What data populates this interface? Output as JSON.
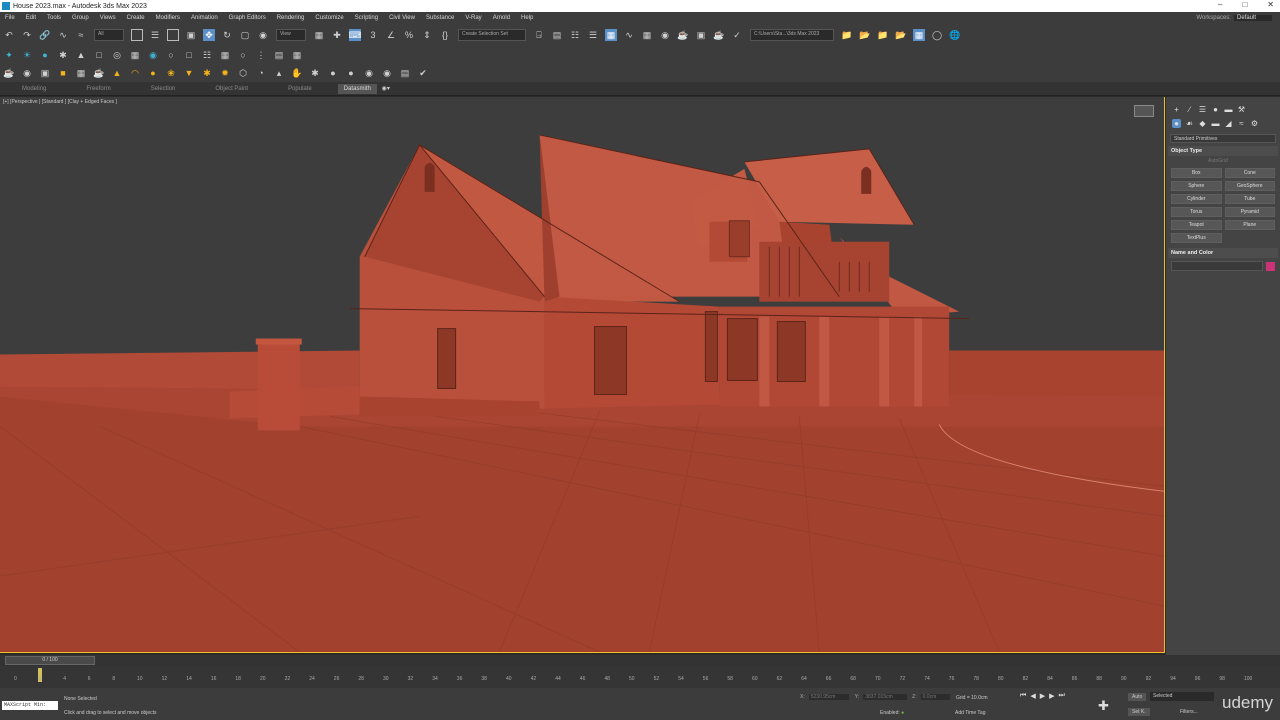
{
  "window": {
    "title": "House 2023.max - Autodesk 3ds Max 2023",
    "controls": [
      "–",
      "□",
      "✕"
    ]
  },
  "menu": {
    "items": [
      "File",
      "Edit",
      "Tools",
      "Group",
      "Views",
      "Create",
      "Modifiers",
      "Animation",
      "Graph Editors",
      "Rendering",
      "Customize",
      "Scripting",
      "Civil View",
      "Substance",
      "V-Ray",
      "Arnold",
      "Help"
    ],
    "workspaces_label": "Workspaces:",
    "workspace_value": "Default"
  },
  "toolbar": {
    "selection_filter": "All",
    "view_dropdown": "View",
    "create_selection_set": "Create Selection Set",
    "project_path": "C:\\Users\\Sta...\\3ds Max 2023"
  },
  "ribbon": {
    "tabs": [
      "Modeling",
      "Freeform",
      "Selection",
      "Object Paint",
      "Populate",
      "Datasmith"
    ],
    "active_tab": "Datasmith"
  },
  "viewport": {
    "label": "[+] [Perspective ] [Standard ] [Clay + Edged Faces ]"
  },
  "command_panel": {
    "category": "Standard Primitives",
    "object_type_title": "Object Type",
    "autogrid": "AutoGrid",
    "buttons": [
      "Box",
      "Cone",
      "Sphere",
      "GeoSphere",
      "Cylinder",
      "Tube",
      "Torus",
      "Pyramid",
      "Teapot",
      "Plane",
      "TextPlus"
    ],
    "name_color_title": "Name and Color",
    "color_swatch": "#cc3377"
  },
  "time_slider": {
    "label": "0 / 100"
  },
  "trackbar": {
    "ticks": [
      "0",
      "2",
      "4",
      "6",
      "8",
      "10",
      "12",
      "14",
      "16",
      "18",
      "20",
      "22",
      "24",
      "26",
      "28",
      "30",
      "32",
      "34",
      "36",
      "38",
      "40",
      "42",
      "44",
      "46",
      "48",
      "50",
      "52",
      "54",
      "56",
      "58",
      "60",
      "62",
      "64",
      "66",
      "68",
      "70",
      "72",
      "74",
      "76",
      "78",
      "80",
      "82",
      "84",
      "86",
      "88",
      "90",
      "92",
      "94",
      "96",
      "98",
      "100"
    ]
  },
  "status": {
    "maxscript": "MAXScript Min:",
    "selection": "None Selected",
    "prompt": "Click and drag to select and move objects",
    "x_label": "X:",
    "x_value": "5230.95cm",
    "y_label": "Y:",
    "y_value": "3837.015cm",
    "z_label": "Z:",
    "z_value": "0.0cm",
    "grid": "Grid = 10.0cm",
    "enabled": "Enabled:",
    "add_time_tag": "Add Time Tag",
    "auto": "Auto",
    "selected": "Selected",
    "set_k": "Set K.",
    "filters": "Filters..."
  },
  "watermark": "udemy"
}
